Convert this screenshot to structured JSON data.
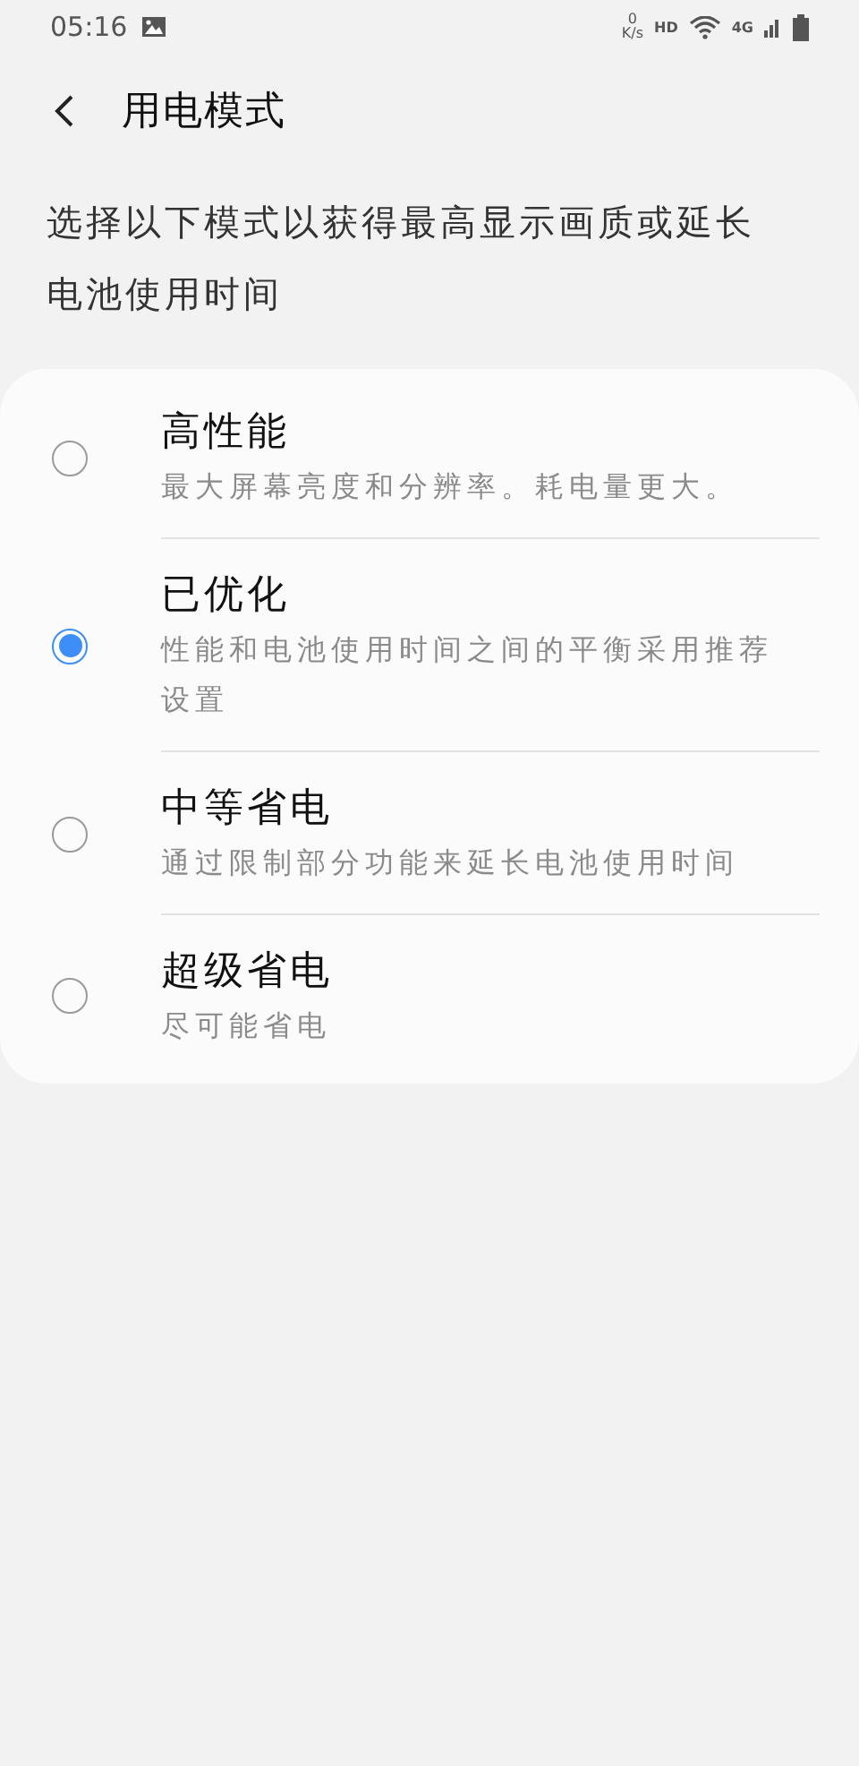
{
  "status_bar": {
    "time": "05:16",
    "speed_value": "0",
    "speed_unit": "K/s",
    "hd": "HD",
    "network": "4G"
  },
  "header": {
    "title": "用电模式"
  },
  "intro": "选择以下模式以获得最高显示画质或延长电池使用时间",
  "modes": [
    {
      "title": "高性能",
      "description": "最大屏幕亮度和分辨率。耗电量更大。",
      "selected": false
    },
    {
      "title": "已优化",
      "description": "性能和电池使用时间之间的平衡采用推荐设置",
      "selected": true
    },
    {
      "title": "中等省电",
      "description": "通过限制部分功能来延长电池使用时间",
      "selected": false
    },
    {
      "title": "超级省电",
      "description": "尽可能省电",
      "selected": false
    }
  ]
}
